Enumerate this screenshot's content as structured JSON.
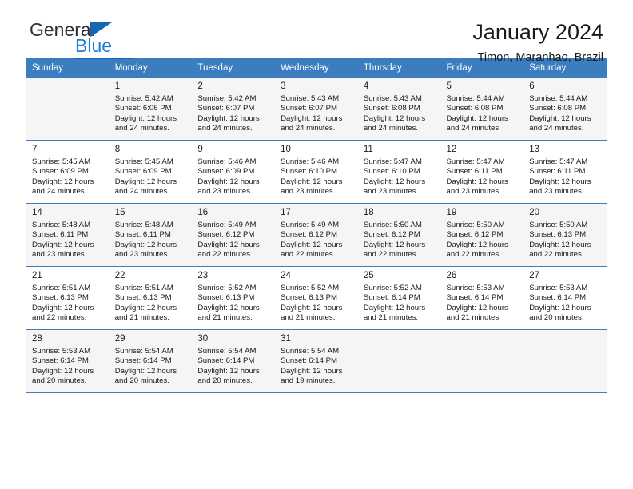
{
  "brand": {
    "name_part1": "General",
    "name_part2": "Blue",
    "flag_icon": "blue-triangle-flag-icon"
  },
  "header": {
    "title": "January 2024",
    "subtitle": "Timon, Maranhao, Brazil"
  },
  "colors": {
    "header_blue": "#3b7dbf",
    "brand_blue": "#1c7fd4",
    "flag_blue": "#1567b3",
    "alt_row": "#f5f5f5"
  },
  "calendar": {
    "weekday_headers": [
      "Sunday",
      "Monday",
      "Tuesday",
      "Wednesday",
      "Thursday",
      "Friday",
      "Saturday"
    ],
    "weeks": [
      [
        {
          "day": "",
          "sunrise": "",
          "sunset": "",
          "daylight_line1": "",
          "daylight_line2": ""
        },
        {
          "day": "1",
          "sunrise": "Sunrise: 5:42 AM",
          "sunset": "Sunset: 6:06 PM",
          "daylight_line1": "Daylight: 12 hours",
          "daylight_line2": "and 24 minutes."
        },
        {
          "day": "2",
          "sunrise": "Sunrise: 5:42 AM",
          "sunset": "Sunset: 6:07 PM",
          "daylight_line1": "Daylight: 12 hours",
          "daylight_line2": "and 24 minutes."
        },
        {
          "day": "3",
          "sunrise": "Sunrise: 5:43 AM",
          "sunset": "Sunset: 6:07 PM",
          "daylight_line1": "Daylight: 12 hours",
          "daylight_line2": "and 24 minutes."
        },
        {
          "day": "4",
          "sunrise": "Sunrise: 5:43 AM",
          "sunset": "Sunset: 6:08 PM",
          "daylight_line1": "Daylight: 12 hours",
          "daylight_line2": "and 24 minutes."
        },
        {
          "day": "5",
          "sunrise": "Sunrise: 5:44 AM",
          "sunset": "Sunset: 6:08 PM",
          "daylight_line1": "Daylight: 12 hours",
          "daylight_line2": "and 24 minutes."
        },
        {
          "day": "6",
          "sunrise": "Sunrise: 5:44 AM",
          "sunset": "Sunset: 6:08 PM",
          "daylight_line1": "Daylight: 12 hours",
          "daylight_line2": "and 24 minutes."
        }
      ],
      [
        {
          "day": "7",
          "sunrise": "Sunrise: 5:45 AM",
          "sunset": "Sunset: 6:09 PM",
          "daylight_line1": "Daylight: 12 hours",
          "daylight_line2": "and 24 minutes."
        },
        {
          "day": "8",
          "sunrise": "Sunrise: 5:45 AM",
          "sunset": "Sunset: 6:09 PM",
          "daylight_line1": "Daylight: 12 hours",
          "daylight_line2": "and 24 minutes."
        },
        {
          "day": "9",
          "sunrise": "Sunrise: 5:46 AM",
          "sunset": "Sunset: 6:09 PM",
          "daylight_line1": "Daylight: 12 hours",
          "daylight_line2": "and 23 minutes."
        },
        {
          "day": "10",
          "sunrise": "Sunrise: 5:46 AM",
          "sunset": "Sunset: 6:10 PM",
          "daylight_line1": "Daylight: 12 hours",
          "daylight_line2": "and 23 minutes."
        },
        {
          "day": "11",
          "sunrise": "Sunrise: 5:47 AM",
          "sunset": "Sunset: 6:10 PM",
          "daylight_line1": "Daylight: 12 hours",
          "daylight_line2": "and 23 minutes."
        },
        {
          "day": "12",
          "sunrise": "Sunrise: 5:47 AM",
          "sunset": "Sunset: 6:11 PM",
          "daylight_line1": "Daylight: 12 hours",
          "daylight_line2": "and 23 minutes."
        },
        {
          "day": "13",
          "sunrise": "Sunrise: 5:47 AM",
          "sunset": "Sunset: 6:11 PM",
          "daylight_line1": "Daylight: 12 hours",
          "daylight_line2": "and 23 minutes."
        }
      ],
      [
        {
          "day": "14",
          "sunrise": "Sunrise: 5:48 AM",
          "sunset": "Sunset: 6:11 PM",
          "daylight_line1": "Daylight: 12 hours",
          "daylight_line2": "and 23 minutes."
        },
        {
          "day": "15",
          "sunrise": "Sunrise: 5:48 AM",
          "sunset": "Sunset: 6:11 PM",
          "daylight_line1": "Daylight: 12 hours",
          "daylight_line2": "and 23 minutes."
        },
        {
          "day": "16",
          "sunrise": "Sunrise: 5:49 AM",
          "sunset": "Sunset: 6:12 PM",
          "daylight_line1": "Daylight: 12 hours",
          "daylight_line2": "and 22 minutes."
        },
        {
          "day": "17",
          "sunrise": "Sunrise: 5:49 AM",
          "sunset": "Sunset: 6:12 PM",
          "daylight_line1": "Daylight: 12 hours",
          "daylight_line2": "and 22 minutes."
        },
        {
          "day": "18",
          "sunrise": "Sunrise: 5:50 AM",
          "sunset": "Sunset: 6:12 PM",
          "daylight_line1": "Daylight: 12 hours",
          "daylight_line2": "and 22 minutes."
        },
        {
          "day": "19",
          "sunrise": "Sunrise: 5:50 AM",
          "sunset": "Sunset: 6:12 PM",
          "daylight_line1": "Daylight: 12 hours",
          "daylight_line2": "and 22 minutes."
        },
        {
          "day": "20",
          "sunrise": "Sunrise: 5:50 AM",
          "sunset": "Sunset: 6:13 PM",
          "daylight_line1": "Daylight: 12 hours",
          "daylight_line2": "and 22 minutes."
        }
      ],
      [
        {
          "day": "21",
          "sunrise": "Sunrise: 5:51 AM",
          "sunset": "Sunset: 6:13 PM",
          "daylight_line1": "Daylight: 12 hours",
          "daylight_line2": "and 22 minutes."
        },
        {
          "day": "22",
          "sunrise": "Sunrise: 5:51 AM",
          "sunset": "Sunset: 6:13 PM",
          "daylight_line1": "Daylight: 12 hours",
          "daylight_line2": "and 21 minutes."
        },
        {
          "day": "23",
          "sunrise": "Sunrise: 5:52 AM",
          "sunset": "Sunset: 6:13 PM",
          "daylight_line1": "Daylight: 12 hours",
          "daylight_line2": "and 21 minutes."
        },
        {
          "day": "24",
          "sunrise": "Sunrise: 5:52 AM",
          "sunset": "Sunset: 6:13 PM",
          "daylight_line1": "Daylight: 12 hours",
          "daylight_line2": "and 21 minutes."
        },
        {
          "day": "25",
          "sunrise": "Sunrise: 5:52 AM",
          "sunset": "Sunset: 6:14 PM",
          "daylight_line1": "Daylight: 12 hours",
          "daylight_line2": "and 21 minutes."
        },
        {
          "day": "26",
          "sunrise": "Sunrise: 5:53 AM",
          "sunset": "Sunset: 6:14 PM",
          "daylight_line1": "Daylight: 12 hours",
          "daylight_line2": "and 21 minutes."
        },
        {
          "day": "27",
          "sunrise": "Sunrise: 5:53 AM",
          "sunset": "Sunset: 6:14 PM",
          "daylight_line1": "Daylight: 12 hours",
          "daylight_line2": "and 20 minutes."
        }
      ],
      [
        {
          "day": "28",
          "sunrise": "Sunrise: 5:53 AM",
          "sunset": "Sunset: 6:14 PM",
          "daylight_line1": "Daylight: 12 hours",
          "daylight_line2": "and 20 minutes."
        },
        {
          "day": "29",
          "sunrise": "Sunrise: 5:54 AM",
          "sunset": "Sunset: 6:14 PM",
          "daylight_line1": "Daylight: 12 hours",
          "daylight_line2": "and 20 minutes."
        },
        {
          "day": "30",
          "sunrise": "Sunrise: 5:54 AM",
          "sunset": "Sunset: 6:14 PM",
          "daylight_line1": "Daylight: 12 hours",
          "daylight_line2": "and 20 minutes."
        },
        {
          "day": "31",
          "sunrise": "Sunrise: 5:54 AM",
          "sunset": "Sunset: 6:14 PM",
          "daylight_line1": "Daylight: 12 hours",
          "daylight_line2": "and 19 minutes."
        },
        {
          "day": "",
          "sunrise": "",
          "sunset": "",
          "daylight_line1": "",
          "daylight_line2": ""
        },
        {
          "day": "",
          "sunrise": "",
          "sunset": "",
          "daylight_line1": "",
          "daylight_line2": ""
        },
        {
          "day": "",
          "sunrise": "",
          "sunset": "",
          "daylight_line1": "",
          "daylight_line2": ""
        }
      ]
    ]
  }
}
